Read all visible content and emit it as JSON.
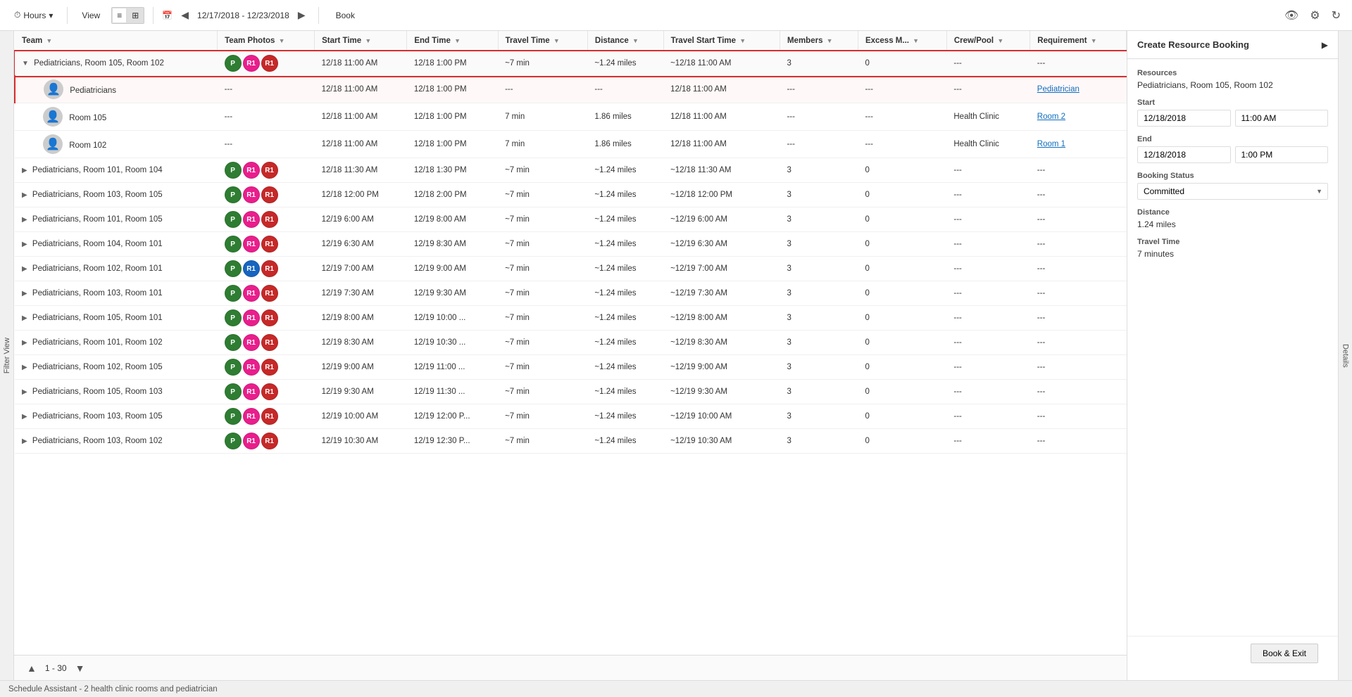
{
  "toolbar": {
    "hours_label": "Hours",
    "view_label": "View",
    "date_range": "12/17/2018 - 12/23/2018",
    "book_label": "Book"
  },
  "top_icons": {
    "eye": "👁",
    "gear": "⚙",
    "refresh": "↻"
  },
  "left_sidebar": {
    "label": "Filter View"
  },
  "right_sidebar": {
    "label": "Details"
  },
  "table": {
    "columns": [
      {
        "id": "team",
        "label": "Team"
      },
      {
        "id": "team_photos",
        "label": "Team Photos"
      },
      {
        "id": "start_time",
        "label": "Start Time"
      },
      {
        "id": "end_time",
        "label": "End Time"
      },
      {
        "id": "travel_time",
        "label": "Travel Time"
      },
      {
        "id": "distance",
        "label": "Distance"
      },
      {
        "id": "travel_start_time",
        "label": "Travel Start Time"
      },
      {
        "id": "members",
        "label": "Members"
      },
      {
        "id": "excess_m",
        "label": "Excess M..."
      },
      {
        "id": "crew_pool",
        "label": "Crew/Pool"
      },
      {
        "id": "requirement",
        "label": "Requirement"
      }
    ],
    "groups": [
      {
        "id": "g1",
        "expanded": true,
        "highlighted": true,
        "team": "Pediatricians, Room 105, Room 102",
        "avatars": [
          {
            "letter": "P",
            "color": "green"
          },
          {
            "letter": "R1",
            "color": "pink"
          },
          {
            "letter": "R1",
            "color": "red"
          }
        ],
        "start_time": "12/18 11:00 AM",
        "end_time": "12/18 1:00 PM",
        "travel_time": "~7 min",
        "distance": "~1.24 miles",
        "travel_start_time": "~12/18 11:00 AM",
        "members": "3",
        "excess_m": "0",
        "crew_pool": "---",
        "requirement": "---",
        "children": [
          {
            "id": "c1",
            "selected": true,
            "avatar_type": "person",
            "team": "Pediatricians",
            "start_time": "12/18 11:00 AM",
            "end_time": "12/18 1:00 PM",
            "travel_time": "---",
            "distance": "---",
            "travel_start_time": "12/18 11:00 AM",
            "members": "---",
            "excess_m": "---",
            "crew_pool": "---",
            "requirement": "Pediatrician",
            "requirement_link": true
          },
          {
            "id": "c2",
            "selected": false,
            "avatar_type": "person",
            "team": "Room 105",
            "start_time": "12/18 11:00 AM",
            "end_time": "12/18 1:00 PM",
            "travel_time": "7 min",
            "distance": "1.86 miles",
            "travel_start_time": "12/18 11:00 AM",
            "members": "---",
            "excess_m": "---",
            "crew_pool": "Health Clinic",
            "requirement": "Room 2",
            "requirement_link": true
          },
          {
            "id": "c3",
            "selected": false,
            "avatar_type": "person",
            "team": "Room 102",
            "start_time": "12/18 11:00 AM",
            "end_time": "12/18 1:00 PM",
            "travel_time": "7 min",
            "distance": "1.86 miles",
            "travel_start_time": "12/18 11:00 AM",
            "members": "---",
            "excess_m": "---",
            "crew_pool": "Health Clinic",
            "requirement": "Room 1",
            "requirement_link": true
          }
        ]
      },
      {
        "id": "g2",
        "expanded": false,
        "highlighted": false,
        "team": "Pediatricians, Room 101, Room 104",
        "avatars": [
          {
            "letter": "P",
            "color": "green"
          },
          {
            "letter": "R1",
            "color": "pink"
          },
          {
            "letter": "R1",
            "color": "red"
          }
        ],
        "start_time": "12/18 11:30 AM",
        "end_time": "12/18 1:30 PM",
        "travel_time": "~7 min",
        "distance": "~1.24 miles",
        "travel_start_time": "~12/18 11:30 AM",
        "members": "3",
        "excess_m": "0",
        "crew_pool": "---",
        "requirement": "---"
      },
      {
        "id": "g3",
        "expanded": false,
        "highlighted": false,
        "team": "Pediatricians, Room 103, Room 105",
        "avatars": [
          {
            "letter": "P",
            "color": "green"
          },
          {
            "letter": "R1",
            "color": "pink"
          },
          {
            "letter": "R1",
            "color": "red"
          }
        ],
        "start_time": "12/18 12:00 PM",
        "end_time": "12/18 2:00 PM",
        "travel_time": "~7 min",
        "distance": "~1.24 miles",
        "travel_start_time": "~12/18 12:00 PM",
        "members": "3",
        "excess_m": "0",
        "crew_pool": "---",
        "requirement": "---"
      },
      {
        "id": "g4",
        "expanded": false,
        "highlighted": false,
        "team": "Pediatricians, Room 101, Room 105",
        "avatars": [
          {
            "letter": "P",
            "color": "green"
          },
          {
            "letter": "R1",
            "color": "pink"
          },
          {
            "letter": "R1",
            "color": "red"
          }
        ],
        "start_time": "12/19 6:00 AM",
        "end_time": "12/19 8:00 AM",
        "travel_time": "~7 min",
        "distance": "~1.24 miles",
        "travel_start_time": "~12/19 6:00 AM",
        "members": "3",
        "excess_m": "0",
        "crew_pool": "---",
        "requirement": "---"
      },
      {
        "id": "g5",
        "expanded": false,
        "highlighted": false,
        "team": "Pediatricians, Room 104, Room 101",
        "avatars": [
          {
            "letter": "P",
            "color": "green"
          },
          {
            "letter": "R1",
            "color": "pink"
          },
          {
            "letter": "R1",
            "color": "red"
          }
        ],
        "start_time": "12/19 6:30 AM",
        "end_time": "12/19 8:30 AM",
        "travel_time": "~7 min",
        "distance": "~1.24 miles",
        "travel_start_time": "~12/19 6:30 AM",
        "members": "3",
        "excess_m": "0",
        "crew_pool": "---",
        "requirement": "---"
      },
      {
        "id": "g6",
        "expanded": false,
        "highlighted": false,
        "team": "Pediatricians, Room 102, Room 101",
        "avatars": [
          {
            "letter": "P",
            "color": "green"
          },
          {
            "letter": "R1",
            "color": "blue"
          },
          {
            "letter": "R1",
            "color": "red"
          }
        ],
        "start_time": "12/19 7:00 AM",
        "end_time": "12/19 9:00 AM",
        "travel_time": "~7 min",
        "distance": "~1.24 miles",
        "travel_start_time": "~12/19 7:00 AM",
        "members": "3",
        "excess_m": "0",
        "crew_pool": "---",
        "requirement": "---"
      },
      {
        "id": "g7",
        "expanded": false,
        "highlighted": false,
        "team": "Pediatricians, Room 103, Room 101",
        "avatars": [
          {
            "letter": "P",
            "color": "green"
          },
          {
            "letter": "R1",
            "color": "pink"
          },
          {
            "letter": "R1",
            "color": "red"
          }
        ],
        "start_time": "12/19 7:30 AM",
        "end_time": "12/19 9:30 AM",
        "travel_time": "~7 min",
        "distance": "~1.24 miles",
        "travel_start_time": "~12/19 7:30 AM",
        "members": "3",
        "excess_m": "0",
        "crew_pool": "---",
        "requirement": "---"
      },
      {
        "id": "g8",
        "expanded": false,
        "highlighted": false,
        "team": "Pediatricians, Room 105, Room 101",
        "avatars": [
          {
            "letter": "P",
            "color": "green"
          },
          {
            "letter": "R1",
            "color": "pink"
          },
          {
            "letter": "R1",
            "color": "red"
          }
        ],
        "start_time": "12/19 8:00 AM",
        "end_time": "12/19 10:00 ...",
        "travel_time": "~7 min",
        "distance": "~1.24 miles",
        "travel_start_time": "~12/19 8:00 AM",
        "members": "3",
        "excess_m": "0",
        "crew_pool": "---",
        "requirement": "---"
      },
      {
        "id": "g9",
        "expanded": false,
        "highlighted": false,
        "team": "Pediatricians, Room 101, Room 102",
        "avatars": [
          {
            "letter": "P",
            "color": "green"
          },
          {
            "letter": "R1",
            "color": "pink"
          },
          {
            "letter": "R1",
            "color": "red"
          }
        ],
        "start_time": "12/19 8:30 AM",
        "end_time": "12/19 10:30 ...",
        "travel_time": "~7 min",
        "distance": "~1.24 miles",
        "travel_start_time": "~12/19 8:30 AM",
        "members": "3",
        "excess_m": "0",
        "crew_pool": "---",
        "requirement": "---"
      },
      {
        "id": "g10",
        "expanded": false,
        "highlighted": false,
        "team": "Pediatricians, Room 102, Room 105",
        "avatars": [
          {
            "letter": "P",
            "color": "green"
          },
          {
            "letter": "R1",
            "color": "pink"
          },
          {
            "letter": "R1",
            "color": "red"
          }
        ],
        "start_time": "12/19 9:00 AM",
        "end_time": "12/19 11:00 ...",
        "travel_time": "~7 min",
        "distance": "~1.24 miles",
        "travel_start_time": "~12/19 9:00 AM",
        "members": "3",
        "excess_m": "0",
        "crew_pool": "---",
        "requirement": "---"
      },
      {
        "id": "g11",
        "expanded": false,
        "highlighted": false,
        "team": "Pediatricians, Room 105, Room 103",
        "avatars": [
          {
            "letter": "P",
            "color": "green"
          },
          {
            "letter": "R1",
            "color": "pink"
          },
          {
            "letter": "R1",
            "color": "red"
          }
        ],
        "start_time": "12/19 9:30 AM",
        "end_time": "12/19 11:30 ...",
        "travel_time": "~7 min",
        "distance": "~1.24 miles",
        "travel_start_time": "~12/19 9:30 AM",
        "members": "3",
        "excess_m": "0",
        "crew_pool": "---",
        "requirement": "---"
      },
      {
        "id": "g12",
        "expanded": false,
        "highlighted": false,
        "team": "Pediatricians, Room 103, Room 105",
        "avatars": [
          {
            "letter": "P",
            "color": "green"
          },
          {
            "letter": "R1",
            "color": "pink"
          },
          {
            "letter": "R1",
            "color": "red"
          }
        ],
        "start_time": "12/19 10:00 AM",
        "end_time": "12/19 12:00 P...",
        "travel_time": "~7 min",
        "distance": "~1.24 miles",
        "travel_start_time": "~12/19 10:00 AM",
        "members": "3",
        "excess_m": "0",
        "crew_pool": "---",
        "requirement": "---"
      },
      {
        "id": "g13",
        "expanded": false,
        "highlighted": false,
        "team": "Pediatricians, Room 103, Room 102",
        "avatars": [
          {
            "letter": "P",
            "color": "green"
          },
          {
            "letter": "R1",
            "color": "pink"
          },
          {
            "letter": "R1",
            "color": "red"
          }
        ],
        "start_time": "12/19 10:30 AM",
        "end_time": "12/19 12:30 P...",
        "travel_time": "~7 min",
        "distance": "~1.24 miles",
        "travel_start_time": "~12/19 10:30 AM",
        "members": "3",
        "excess_m": "0",
        "crew_pool": "---",
        "requirement": "---"
      }
    ]
  },
  "right_panel": {
    "title": "Create Resource Booking",
    "resources_label": "Resources",
    "resources_value": "Pediatricians, Room 105, Room 102",
    "start_label": "Start",
    "start_date": "12/18/2018",
    "start_time": "11:00 AM",
    "end_label": "End",
    "end_date": "12/18/2018",
    "end_time": "1:00 PM",
    "booking_status_label": "Booking Status",
    "booking_status_value": "Committed",
    "distance_label": "Distance",
    "distance_value": "1.24 miles",
    "travel_time_label": "Travel Time",
    "travel_time_value": "7 minutes",
    "book_exit_label": "Book & Exit"
  },
  "bottom_bar": {
    "pagination_start": "1",
    "pagination_end": "30"
  },
  "status_bar": {
    "text": "Schedule Assistant - 2 health clinic rooms and pediatrician"
  }
}
